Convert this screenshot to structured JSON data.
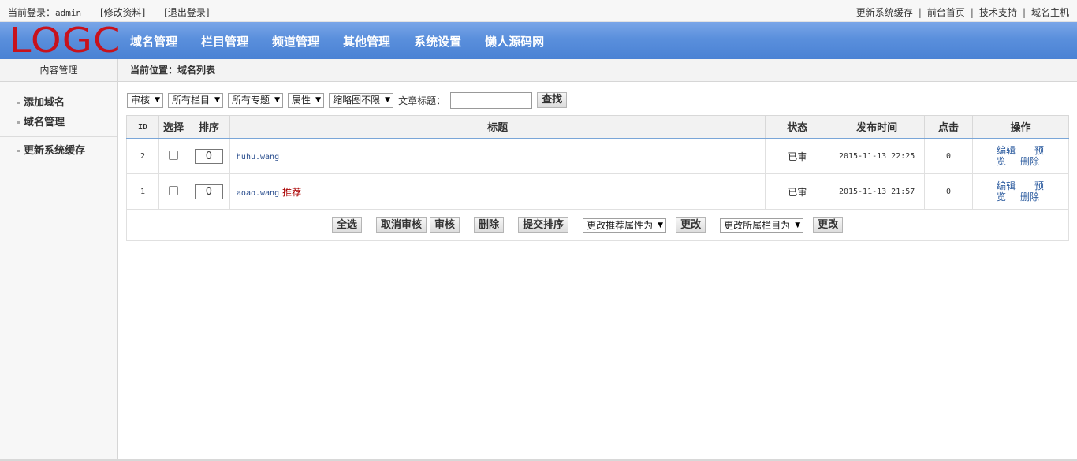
{
  "topbar": {
    "login_label": "当前登录：",
    "user": "admin",
    "edit_profile": "[修改资料]",
    "logout": "[退出登录]",
    "links": [
      "更新系统缓存",
      "前台首页",
      "技术支持",
      "域名主机"
    ]
  },
  "header": {
    "logo": "LOGC",
    "nav": [
      "域名管理",
      "栏目管理",
      "频道管理",
      "其他管理",
      "系统设置",
      "懒人源码网"
    ]
  },
  "sidebar": {
    "title": "内容管理",
    "items": [
      "添加域名",
      "域名管理"
    ],
    "items2": [
      "更新系统缓存"
    ]
  },
  "breadcrumb": "当前位置：域名列表",
  "filters": {
    "selects": [
      "审核",
      "所有栏目",
      "所有专题",
      "属性",
      "缩略图不限"
    ],
    "title_label": "文章标题：",
    "title_value": "",
    "search_button": "查找"
  },
  "table": {
    "columns": [
      "ID",
      "选择",
      "排序",
      "标题",
      "状态",
      "发布时间",
      "点击",
      "操作"
    ],
    "rows": [
      {
        "id": "2",
        "sort": "0",
        "title": "huhu.wang",
        "badge": "",
        "status": "已审",
        "time": "2015-11-13 22:25",
        "clicks": "0"
      },
      {
        "id": "1",
        "sort": "0",
        "title": "aoao.wang",
        "badge": "推荐",
        "status": "已审",
        "time": "2015-11-13 21:57",
        "clicks": "0"
      }
    ],
    "ops": {
      "edit": "编辑",
      "preview_a": "预",
      "preview_b": "览",
      "delete": "删除"
    }
  },
  "actions": {
    "select_all": "全选",
    "unapprove": "取消审核",
    "approve": "审核",
    "delete": "删除",
    "submit_sort": "提交排序",
    "recommend_select": "更改推荐属性为",
    "change1": "更改",
    "category_select": "更改所属栏目为",
    "change2": "更改"
  }
}
